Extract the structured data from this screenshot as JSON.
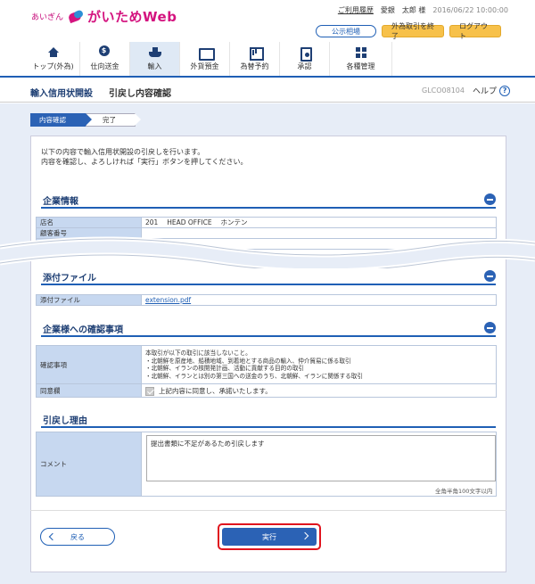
{
  "header": {
    "bank_name": "あいぎん",
    "app_name": "がいためWeb",
    "usage_history": "ご利用履歴",
    "user_name": "愛銀　太郎 様",
    "datetime": "2016/06/22 10:00:00",
    "public_rates": "公示相場",
    "end_fx_trading": "外為取引を終了",
    "logout": "ログアウト"
  },
  "nav": {
    "items": [
      {
        "label": "トップ(外為)",
        "icon": "house-icon"
      },
      {
        "label": "仕向送金",
        "icon": "coin-icon"
      },
      {
        "label": "輸入",
        "icon": "ship-icon"
      },
      {
        "label": "外貨預金",
        "icon": "card-icon"
      },
      {
        "label": "為替予約",
        "icon": "chart-icon"
      },
      {
        "label": "承認",
        "icon": "doc-icon"
      },
      {
        "label": "各種管理",
        "icon": "grid-icon"
      }
    ]
  },
  "titlebar": {
    "title": "輸入信用状開設",
    "subtitle": "引戻し内容確認",
    "screen_code": "GLCO08104",
    "help": "ヘルプ"
  },
  "steps": [
    "内容確認",
    "完了"
  ],
  "intro": {
    "line1": "以下の内容で輸入信用状開設の引戻しを行います。",
    "line2": "内容を確認し、よろしければ「実行」ボタンを押してください。"
  },
  "company_info": {
    "heading": "企業情報",
    "rows": [
      {
        "label": "店名",
        "value": "201　 HEAD OFFICE　 ホンテン"
      },
      {
        "label": "顧客番号",
        "value": ""
      }
    ]
  },
  "attachments": {
    "heading": "添付ファイル",
    "label": "添付ファイル",
    "file": "extension.pdf"
  },
  "confirmation": {
    "heading": "企業様への確認事項",
    "label": "確認事項",
    "text_lines": [
      "本取引が以下の取引に該当しないこと。",
      "・北朝鮮を原産地、船積地域、到着地とする商品の輸入、仲介貿易に係る取引",
      "・北朝鮮、イランの核開発計画、活動に貢献する目的の取引",
      "・北朝鮮、イランとは別の第三国への送金のうち、北朝鮮、イランに関係する取引"
    ],
    "agree_label": "同意欄",
    "agree_text": "上記内容に同意し、承諾いたします。"
  },
  "reason": {
    "heading": "引戻し理由",
    "label": "コメント",
    "comment": "提出書類に不足があるため引戻します",
    "char_limit": "全角半角100文字以内"
  },
  "buttons": {
    "back": "戻る",
    "execute": "実行"
  },
  "colors": {
    "primary": "#2b62b5",
    "brand": "#d4137f",
    "highlight": "#e0141e"
  }
}
